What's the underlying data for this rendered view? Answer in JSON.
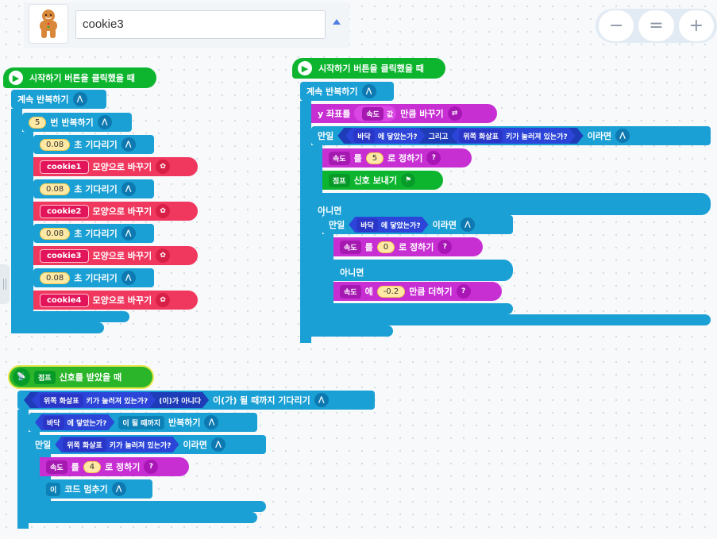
{
  "sprite": {
    "name": "cookie3"
  },
  "zoom": {
    "out": "−",
    "reset": "=",
    "in": "+"
  },
  "s1": {
    "hat": "시작하기 버튼을 클릭했을 때",
    "forever": "계속 반복하기",
    "repeat_count": "5",
    "repeat_label": "번 반복하기",
    "wait_val": "0.08",
    "wait_label": "초 기다리기",
    "shape_label": "모양으로 바꾸기",
    "shapes": [
      "cookie1",
      "cookie2",
      "cookie3",
      "cookie4"
    ]
  },
  "s2": {
    "hat": "시작하기 버튼을 클릭했을 때",
    "forever": "계속 반복하기",
    "changey": "y 좌표를",
    "var": "속도",
    "val_word": "값",
    "changey_tail": "만큼 바꾸기",
    "if": "만일",
    "floor": "바닥",
    "touch": "에 닿았는가?",
    "and": "그리고",
    "up": "위쪽 화살표",
    "key": "키가 눌러져 있는가?",
    "then": "이라면",
    "set_mid": "를",
    "set_val1": "5",
    "set_tail": "로 정하기",
    "jump": "점프",
    "send": "신호 보내기",
    "else": "아니면",
    "set_val2": "0",
    "add_mid": "에",
    "add_val": "-0.2",
    "add_tail": "만큼 더하기"
  },
  "s3": {
    "hat_sig": "점프",
    "hat": "신호를 받았을 때",
    "wait_key": "위쪽 화살표",
    "wait_keytxt": "키가 눌러져 있는가?",
    "not": "(이)가 아니다",
    "wait_tail": "이(가) 될 때까지 기다리기",
    "floor": "바닥",
    "touch": "에 닿았는가?",
    "until": "이 될 때까지",
    "rep": "반복하기",
    "if": "만일",
    "up": "위쪽 화살표",
    "key": "키가 눌러져 있는가?",
    "then": "이라면",
    "var": "속도",
    "set_mid": "를",
    "set_val": "4",
    "set_tail": "로 정하기",
    "stop_dd": "이",
    "stop": "코드 멈추기"
  },
  "colors": {
    "flow": "#1aa0d4",
    "looks": "#f0385f",
    "data": "#c82fd3",
    "event": "#0db52f"
  }
}
